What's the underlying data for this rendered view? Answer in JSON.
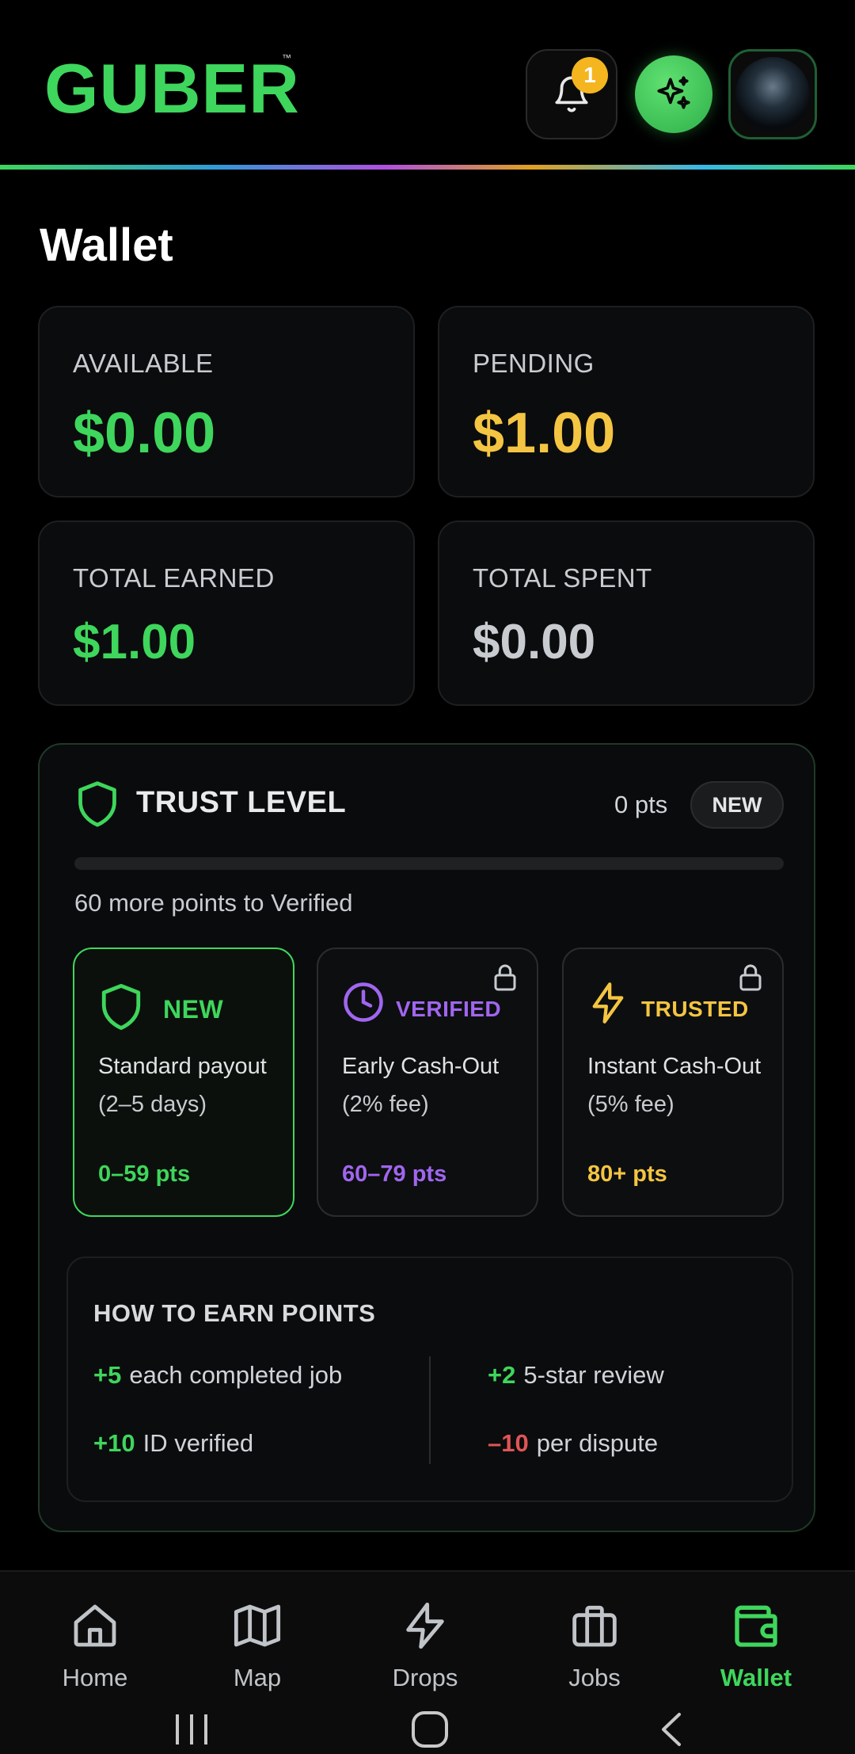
{
  "header": {
    "logo": "GUBER",
    "logo_tm": "™",
    "notification_count": "1"
  },
  "page_title": "Wallet",
  "stats": {
    "available": {
      "label": "AVAILABLE",
      "value": "$0.00",
      "color": "#3ed65c"
    },
    "pending": {
      "label": "PENDING",
      "value": "$1.00",
      "color": "#f4c542"
    },
    "total_earned": {
      "label": "TOTAL EARNED",
      "value": "$1.00",
      "color": "#3ed65c"
    },
    "total_spent": {
      "label": "TOTAL SPENT",
      "value": "$0.00",
      "color": "#c8ccd0"
    }
  },
  "trust": {
    "title": "TRUST LEVEL",
    "points": "0 pts",
    "level_badge": "NEW",
    "progress_fraction": 0,
    "note": "60 more points to Verified",
    "tiers": [
      {
        "name": "NEW",
        "desc1": "Standard payout",
        "desc2": "(2–5 days)",
        "range": "0–59 pts",
        "color": "#3ed65c",
        "icon": "shield-icon",
        "locked": false
      },
      {
        "name": "VERIFIED",
        "desc1": "Early Cash-Out",
        "desc2": "(2% fee)",
        "range": "60–79 pts",
        "color": "#a066f0",
        "icon": "clock-icon",
        "locked": true
      },
      {
        "name": "TRUSTED",
        "desc1": "Instant Cash-Out",
        "desc2": "(5% fee)",
        "range": "80+ pts",
        "color": "#f4c542",
        "icon": "lightning-icon",
        "locked": true
      }
    ],
    "earn": {
      "title": "HOW TO EARN POINTS",
      "items": [
        {
          "amount": "+5",
          "text": "each completed job",
          "color": "#3ed65c"
        },
        {
          "amount": "+2",
          "text": "5-star review",
          "color": "#3ed65c"
        },
        {
          "amount": "+10",
          "text": "ID verified",
          "color": "#3ed65c"
        },
        {
          "amount": "–10",
          "text": "per dispute",
          "color": "#e05555"
        }
      ]
    }
  },
  "nav": {
    "items": [
      {
        "label": "Home",
        "icon": "home-icon"
      },
      {
        "label": "Map",
        "icon": "map-icon"
      },
      {
        "label": "Drops",
        "icon": "lightning-icon"
      },
      {
        "label": "Jobs",
        "icon": "briefcase-icon"
      },
      {
        "label": "Wallet",
        "icon": "wallet-icon",
        "active": true
      }
    ],
    "active_color": "#3ed65c"
  }
}
